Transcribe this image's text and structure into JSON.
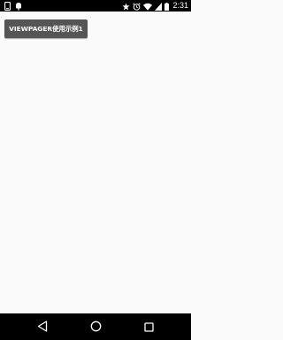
{
  "status_bar": {
    "time": "2:31",
    "left_icons": [
      "phone-notification-icon",
      "android-debug-icon"
    ],
    "right_icons": [
      "star-icon",
      "alarm-icon",
      "wifi-icon",
      "cell-signal-icon",
      "battery-icon"
    ]
  },
  "main": {
    "demo_button_label": "VIEWPAGER使用示例1"
  },
  "nav_bar": {
    "icons": [
      "back-icon",
      "home-icon",
      "recents-icon"
    ]
  },
  "colors": {
    "status_bar": "#000000",
    "background": "#fafafa",
    "button_bg": "#555555",
    "button_text": "#ffffff",
    "nav_bar": "#000000"
  }
}
